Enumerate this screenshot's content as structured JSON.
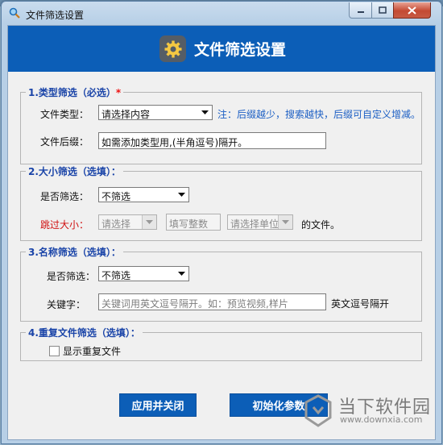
{
  "window": {
    "title": "文件筛选设置"
  },
  "header": {
    "title": "文件筛选设置"
  },
  "type_section": {
    "legend": "1.类型筛选（必选）",
    "required_mark": "*",
    "type_label": "文件类型：",
    "type_value": "请选择内容",
    "note": "注：后缀越少，搜索越快，后缀可自定义增减。",
    "suffix_label": "文件后缀：",
    "suffix_value": "如需添加类型用,(半角逗号)隔开。"
  },
  "size_section": {
    "legend": "2.大小筛选（选填）：",
    "filter_label": "是否筛选：",
    "filter_value": "不筛选",
    "skip_label": "跳过大小：",
    "op_placeholder": "请选择",
    "number_placeholder": "填写整数",
    "unit_placeholder": "请选择单位",
    "suffix_text": "的文件。"
  },
  "name_section": {
    "legend": "3.名称筛选（选填）：",
    "filter_label": "是否筛选：",
    "filter_value": "不筛选",
    "keyword_label": "关键字：",
    "keyword_placeholder": "关键词用英文逗号隔开。如：预览视频,样片",
    "hint": "英文逗号隔开"
  },
  "dup_section": {
    "legend": "4.重复文件筛选（选填）：",
    "checkbox_label": "显示重复文件",
    "checked": false
  },
  "buttons": {
    "apply_close": "应用并关闭",
    "reset": "初始化参数"
  },
  "watermark": {
    "name": "当下软件园",
    "url": "www.downxia.com"
  },
  "colors": {
    "accent": "#0c5eb7",
    "legend": "#1a44a8",
    "required": "#e11111",
    "note": "#1c5fc4",
    "warning_label": "#d01010"
  },
  "icons": {
    "app": "search-icon",
    "header": "gear-icon",
    "dropdown": "chevron-down-icon",
    "window_controls": [
      "minimize-icon",
      "maximize-icon",
      "close-icon"
    ]
  }
}
